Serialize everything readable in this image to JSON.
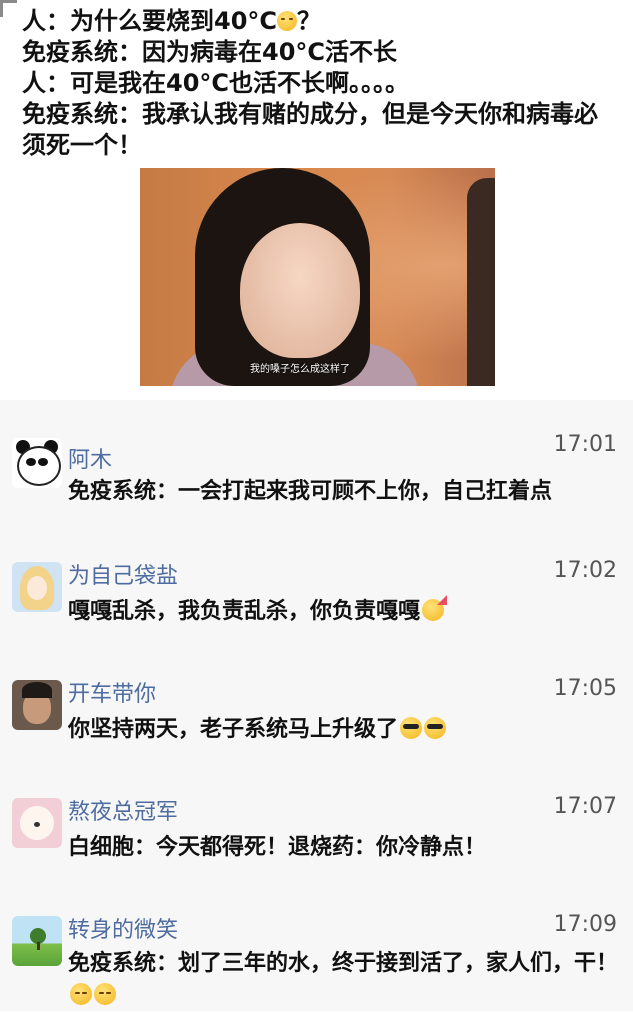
{
  "post": {
    "line1_text": "人：为什么要烧到40°C",
    "line1_end": "？",
    "line2": "免疫系统：因为病毒在40°C活不长",
    "line3": "人：可是我在40°C也活不长啊。。。。",
    "line4": "免疫系统：我承认我有赌的成分，但是今天你和病毒必",
    "line5": "须死一个！",
    "video_subtitle": "我的嗓子怎么成这样了"
  },
  "comments": [
    {
      "user": "阿木",
      "time": "17:01",
      "text": "免疫系统：一会打起来我可顾不上你，自己扛着点",
      "avatar": "panda-avatar",
      "emoji": []
    },
    {
      "user": "为自己袋盐",
      "time": "17:02",
      "text": "嘎嘎乱杀，我负责乱杀，你负责嘎嘎",
      "avatar": "girl-avatar",
      "emoji": [
        "party-face-emoji"
      ]
    },
    {
      "user": "开车带你",
      "time": "17:05",
      "text": "你坚持两天，老子系统马上升级了",
      "avatar": "man-avatar",
      "emoji": [
        "sunglasses-emoji",
        "sunglasses-emoji"
      ]
    },
    {
      "user": "熬夜总冠军",
      "time": "17:07",
      "text": "白细胞：今天都得死！退烧药：你冷静点！",
      "avatar": "dog-avatar",
      "emoji": []
    },
    {
      "user": "转身的微笑",
      "time": "17:09",
      "text": "免疫系统：划了三年的水，终于接到活了，家人们，干！",
      "avatar": "landscape-avatar",
      "emoji": [
        "blush-emoji",
        "blush-emoji"
      ]
    }
  ]
}
